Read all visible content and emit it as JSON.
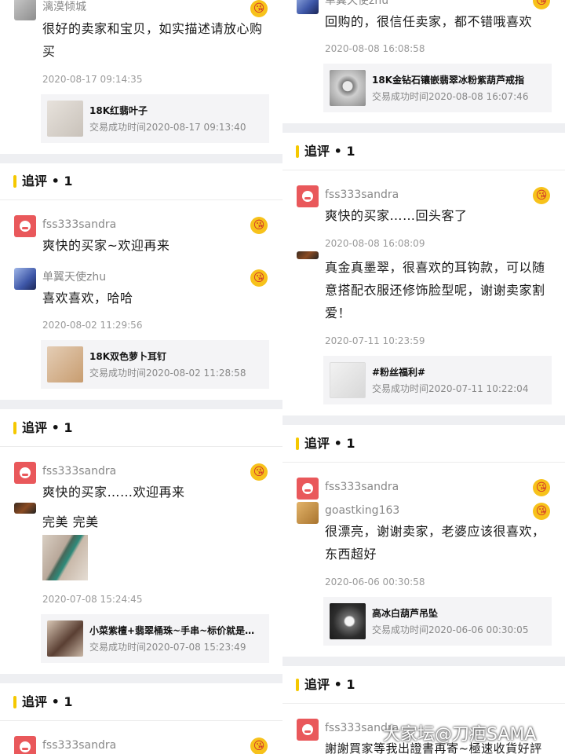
{
  "left": {
    "top_comment": {
      "name": "漓漠倾城",
      "text": "很好的卖家和宝贝，如实描述请放心购买",
      "time": "2020-08-17 09:14:35",
      "product": {
        "name": "18K红翡叶子",
        "status": "交易成功时间2020-08-17 09:13:40"
      }
    },
    "section1": {
      "title": "追评 • 1",
      "reply1": {
        "name": "fss333sandra",
        "text": "爽快的买家~欢迎再来"
      },
      "comment": {
        "name": "单翼天使zhu",
        "text": "喜欢喜欢，哈哈",
        "time": "2020-08-02 11:29:56",
        "product": {
          "name": "18K双色萝卜耳钉",
          "status": "交易成功时间2020-08-02 11:28:58"
        }
      }
    },
    "section2": {
      "title": "追评 • 1",
      "reply1": {
        "name": "fss333sandra",
        "text": "爽快的买家……欢迎再来"
      },
      "comment": {
        "text": "完美  完美",
        "time": "2020-07-08 15:24:45",
        "product": {
          "name": "小菜紫檀+翡翠桶珠~手串~标价就是卖价",
          "status": "交易成功时间2020-07-08 15:23:49"
        }
      }
    },
    "section3": {
      "title": "追评 • 1",
      "reply1": {
        "name": "fss333sandra"
      }
    }
  },
  "right": {
    "top_comment": {
      "name": "单翼天使zhu",
      "text": "回购的，很信任卖家，都不错哦喜欢",
      "time": "2020-08-08 16:08:58",
      "product": {
        "name": "18K金钻石镶嵌翡翠冰粉紫葫芦戒指",
        "status": "交易成功时间2020-08-08 16:07:46"
      }
    },
    "section1": {
      "title": "追评 • 1",
      "reply1": {
        "name": "fss333sandra",
        "text": "爽快的买家……回头客了",
        "time": "2020-08-08 16:08:09"
      },
      "comment": {
        "text": "真金真墨翠，很喜欢的耳钩款，可以随意搭配衣服还修饰脸型呢，谢谢卖家割爱！",
        "time": "2020-07-11 10:23:59",
        "product": {
          "name": "#粉丝福利#",
          "status": "交易成功时间2020-07-11 10:22:04"
        }
      }
    },
    "section2": {
      "title": "追评 • 1",
      "reply1": {
        "name": "fss333sandra"
      },
      "comment": {
        "name": "goastking163",
        "text": "很漂亮，谢谢卖家，老婆应该很喜欢，东西超好",
        "time": "2020-06-06 00:30:58",
        "product": {
          "name": "高冰白葫芦吊坠",
          "status": "交易成功时间2020-06-06 00:30:05"
        }
      }
    },
    "section3": {
      "title": "追评 • 1",
      "reply1": {
        "name": "fss333sandra",
        "text": "謝謝買家等我出證書再寄~極速收貨好評"
      }
    }
  },
  "emoji_glyph": "😘",
  "watermark": "大家坛@刀疤SAMA"
}
